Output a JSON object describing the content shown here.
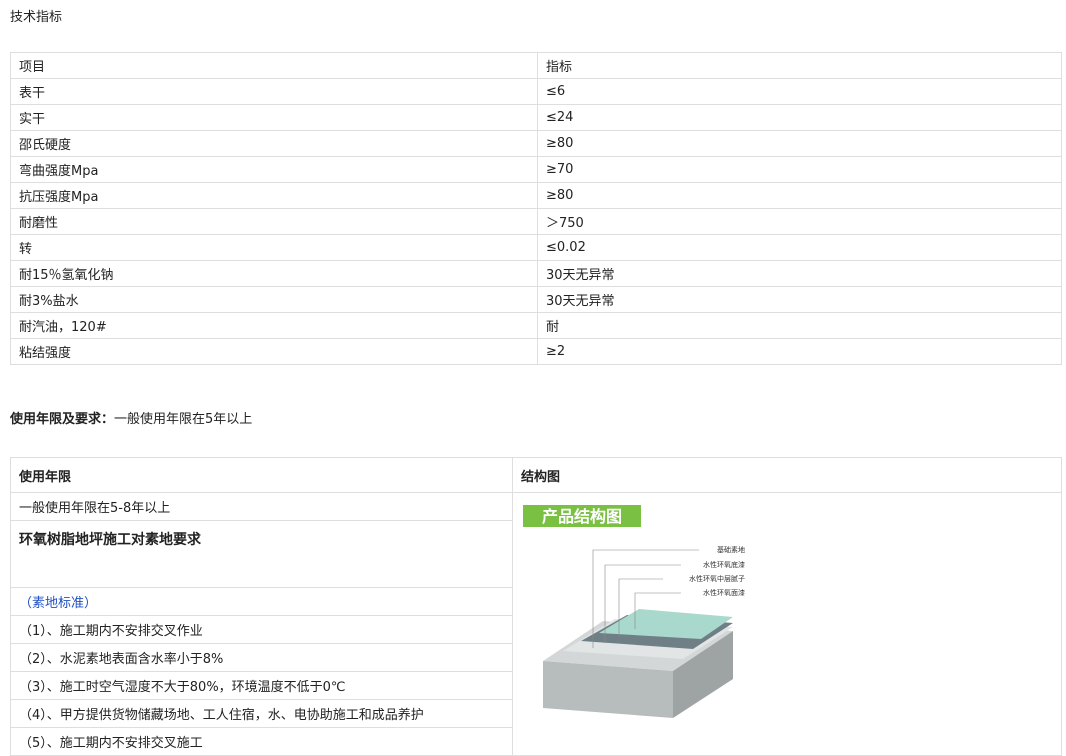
{
  "header": {
    "title": "技术指标"
  },
  "spec_table": {
    "col1": "项目",
    "col2": "指标",
    "rows": [
      {
        "item": "表干",
        "value": "≤6"
      },
      {
        "item": "实干",
        "value": "≤24"
      },
      {
        "item": "邵氏硬度",
        "value": "≥80"
      },
      {
        "item": "弯曲强度Mpa",
        "value": "≥70"
      },
      {
        "item": "抗压强度Mpa",
        "value": "≥80"
      },
      {
        "item": "耐磨性",
        "value": "＞750"
      },
      {
        "item": "转",
        "value": "≤0.02"
      },
      {
        "item": "耐15％氢氧化钠",
        "value": "30天无异常"
      },
      {
        "item": "耐3%盐水",
        "value": "30天无异常"
      },
      {
        "item": "耐汽油，120#",
        "value": "耐"
      },
      {
        "item": "粘结强度",
        "value": "≥2"
      }
    ]
  },
  "usage": {
    "label": "使用年限及要求：",
    "text": "一般使用年限在5年以上"
  },
  "lower_table": {
    "h_left": "使用年限",
    "h_right": "结构图",
    "life_text": "一般使用年限在5-8年以上",
    "req_title": "环氧树脂地坪施工对素地要求",
    "standard_label": "（素地标准）",
    "items": [
      "（1）、施工期内不安排交叉作业",
      "（2）、水泥素地表面含水率小于8%",
      "（3）、施工时空气湿度不大于80%，环境温度不低于0℃",
      "（4）、甲方提供货物储藏场地、工人住宿，水、电协助施工和成品养护",
      "（5）、施工期内不安排交叉施工"
    ]
  },
  "diagram": {
    "banner": "产品结构图",
    "labels": [
      "基础素地",
      "水性环氧底漆",
      "水性环氧中层腻子",
      "水性环氧面漆"
    ],
    "colors": {
      "banner": "#79c043",
      "top": "#a9d8cc",
      "mid": "#6f7f86",
      "putty": "#d8dcdc",
      "base": "#b7bcbc"
    }
  }
}
